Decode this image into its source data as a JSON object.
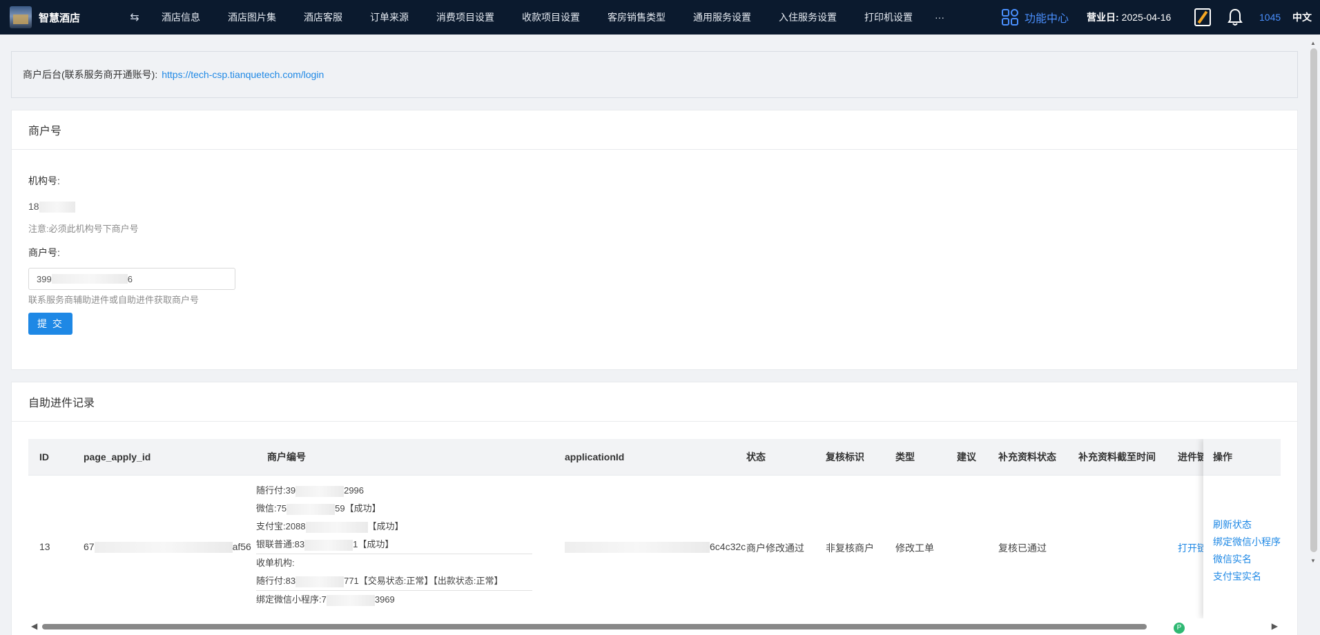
{
  "app": {
    "title": "智慧酒店"
  },
  "nav": {
    "items": [
      "酒店信息",
      "酒店图片集",
      "酒店客服",
      "订单来源",
      "消费项目设置",
      "收款项目设置",
      "客房销售类型",
      "通用服务设置",
      "入住服务设置",
      "打印机设置"
    ],
    "more": "···"
  },
  "header": {
    "function_center": "功能中心",
    "business_day_label": "营业日:",
    "business_day": "2025-04-16",
    "count": "1045",
    "language": "中文"
  },
  "notice": {
    "label": "商户后台(联系服务商开通账号):",
    "url": "https://tech-csp.tianquetech.com/login"
  },
  "merchant_card": {
    "title": "商户号",
    "org_label": "机构号:",
    "org_value_visible": "18",
    "org_note": "注意:必须此机构号下商户号",
    "merchant_label": "商户号:",
    "merchant_input_visible": "399",
    "merchant_input_tail": "6",
    "merchant_hint": "联系服务商辅助进件或自助进件获取商户号",
    "submit": "提 交"
  },
  "records_card": {
    "title": "自助进件记录",
    "columns": [
      "ID",
      "page_apply_id",
      "商户编号",
      "applicationId",
      "状态",
      "复核标识",
      "类型",
      "建议",
      "补充资料状态",
      "补充资料截至时间",
      "进件链"
    ],
    "ops_header": "操作",
    "rows": [
      {
        "id": "13",
        "page_apply_id_head": "67",
        "page_apply_id_tail": "af56",
        "merchant_lines": [
          {
            "label": "随行付:",
            "head": "39",
            "tail": "2996",
            "suffix": ""
          },
          {
            "label": "微信:",
            "head": "75",
            "tail": "59",
            "suffix": "【成功】"
          },
          {
            "label": "支付宝:",
            "head": "2088",
            "tail": "",
            "suffix": "【成功】"
          },
          {
            "label": "银联普通:",
            "head": "83",
            "tail": "1",
            "suffix": "【成功】"
          },
          {
            "label": "收单机构:",
            "head": "",
            "tail": "",
            "suffix": ""
          },
          {
            "label": "随行付:",
            "head": "83",
            "tail": "771",
            "suffix": "【交易状态:正常】【出款状态:正常】"
          },
          {
            "label": "绑定微信小程序:",
            "head": "7",
            "tail": "3969",
            "suffix": ""
          }
        ],
        "application_id_tail": "6c4c32c",
        "status": "商户修改通过",
        "review_flag": "非复核商户",
        "type": "修改工单",
        "suggestion": "",
        "supplement_status": "复核已通过",
        "supplement_deadline": "",
        "link": "打开链",
        "ops": [
          "刷新状态",
          "绑定微信小程序",
          "微信实名",
          "支付宝实名"
        ]
      }
    ]
  }
}
